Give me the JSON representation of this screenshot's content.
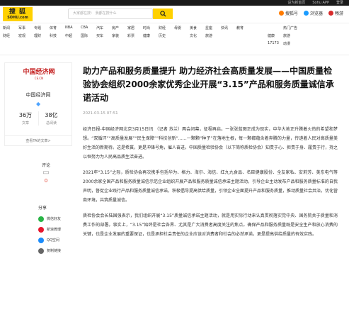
{
  "topbar": {
    "items": [
      "设为新首页",
      "Sohu APP",
      "登录"
    ]
  },
  "header": {
    "logo_cn": "搜 狐",
    "logo_en": "SOHU.com",
    "search_placeholder": "大家都在搜：",
    "search_hint": "我都在搜什么",
    "right_items": [
      {
        "label": "搜狐号",
        "color": "#ff7b00"
      },
      {
        "label": "浏览器",
        "color": "#1a9bff"
      },
      {
        "label": "畅游",
        "color": "#d72a2a"
      }
    ]
  },
  "nav": {
    "row1": [
      "新闻",
      "军事",
      "专题",
      "体育",
      "NBA",
      "CBA",
      "汽车",
      "房产",
      "家居",
      "时尚",
      "财经",
      "母婴",
      "美食",
      "星座",
      "快讯",
      "教育",
      "",
      "",
      " 热门广告"
    ],
    "row2": [
      "财经",
      "宏观",
      "理财",
      "科技",
      "中超",
      "国际",
      "买车",
      "家装",
      "彩票",
      "健康",
      "历史",
      "",
      "文化",
      "旅游",
      "",
      "",
      "",
      "健康",
      "旅游"
    ],
    "row3": [
      "",
      "",
      "",
      "",
      "",
      "",
      "",
      "",
      "",
      "",
      "",
      "",
      "",
      "",
      "",
      "",
      "",
      "17173",
      "动漫"
    ]
  },
  "profile": {
    "logo_title": "中国经济网",
    "logo_sub": "CE.CN",
    "name": "中国经济网",
    "badge_icon": "diamond-icon",
    "stats": [
      {
        "value": "36万",
        "label": "文章"
      },
      {
        "value": "38亿",
        "label": "总阅读"
      }
    ],
    "footer": "查看TA的文章>"
  },
  "comment": {
    "label": "评论",
    "count": "0"
  },
  "share": {
    "label": "分享",
    "items": [
      {
        "label": "微信好友",
        "icon": "wechat-icon",
        "color": "#28b446"
      },
      {
        "label": "新浪微博",
        "icon": "weibo-icon",
        "color": "#e6162d"
      },
      {
        "label": "QQ空间",
        "icon": "qzone-icon",
        "color": "#1b8cfb"
      },
      {
        "label": "复制链接",
        "icon": "link-icon",
        "color": "#666666"
      }
    ]
  },
  "article": {
    "title": "助力产品和服务质量提升 助力经济社会高质量发展——中国质量检验协会组织2000余家优秀企业开展“3.15”产品和服务质量诚信承诺活动",
    "date": "2021-03-15 07:51",
    "paragraphs": [
      "经济日报-中国经济网北京3月15日讯 （记者 苏兰）两会闭幕，征程再启。一张张蓝图正成为现实，中华大地正升腾着火热的希望和梦想。“双循环”“高质量发展”“民生保障”“科技创新”……一颗颗“种子”在落地生根，每一颗都蕴含着奔腾的力量，传递着人民对高质量美好生活的新期待。这是希冀，更是冲锋号角，催人奋进。中国质量检验协会（以下简称质检协会）知责于心、担责于身、履责于行，持之以恒努力为人民高品质生活奋进。",
      "2021年“3.15”之际，质检协会再次携手包括华为、格力、海尔、海信、红九九食品、名臣健康股份、全友家私、安莉芳、美东电气等2000余家全国产品和服务质量诚信示范企业组织开展产品和服务质量诚信承诺主题活动，引导企业主动发布产品和服务质量标准的自我声明，督促企业践行产品和服务质量诚信承诺，积极倡导提高供给质量，引领企业全面提升产品和服务质量，推动质量社会共治，优化营商环境，共筑质量诚信。",
      "质检协会会长陆国强表示，我们组织开展“3.15”质量诚信承诺主题活动，就是用实际行动来认真贯彻落实党中央、国务院关于质量和消费工作的部署。事实上，“3.15”始终是社会各界、尤其是广大消费者高度关注的焦点。确保产品和服务质量既是安全生产和放心消费的关键，也是企业发展的重要保证，也是承担社会责任的企业应该对消费者和社会的必然承诺，更是提高供给质量的有效实践。"
    ]
  }
}
